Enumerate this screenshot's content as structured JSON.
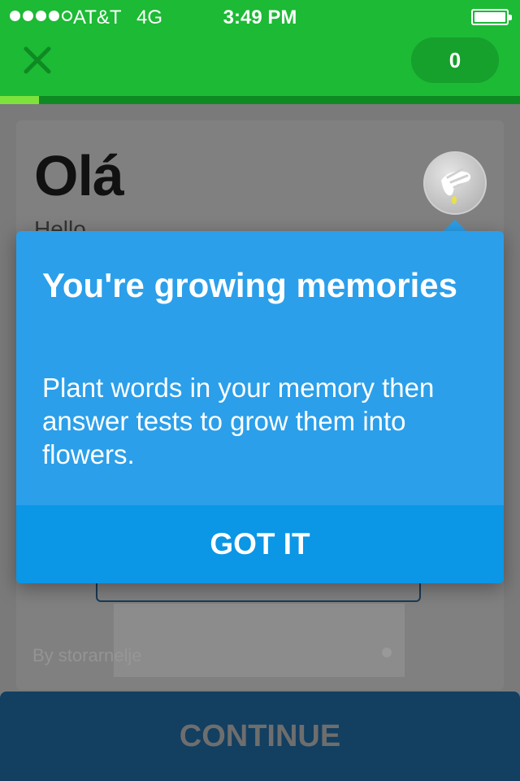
{
  "status_bar": {
    "carrier": "AT&T",
    "network": "4G",
    "time": "3:49 PM",
    "signal_bars_filled": 4,
    "signal_bars_total": 5
  },
  "header": {
    "close_icon": "close-x-icon",
    "score": "0",
    "progress": 0.075,
    "colors": {
      "header": "#1cba35",
      "progress_fill": "#7ee23d"
    }
  },
  "card": {
    "word": "Olá",
    "translation": "Hello",
    "badge_icon": "watering-hand-icon",
    "author_credit": "By storarnelje"
  },
  "popup": {
    "title": "You're growing memories",
    "body": "Plant words in your memory then answer tests to grow them into flowers.",
    "button_label": "GOT IT",
    "colors": {
      "background": "#2b9fea",
      "button": "#0b96e6"
    }
  },
  "footer": {
    "continue_label": "CONTINUE",
    "colors": {
      "background": "#133f61"
    }
  }
}
